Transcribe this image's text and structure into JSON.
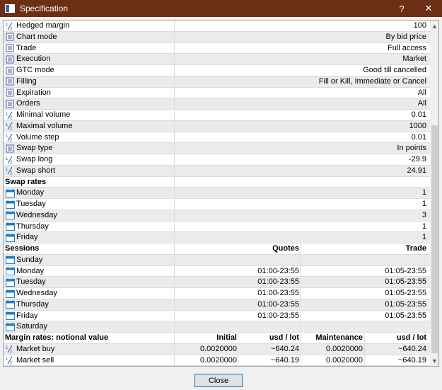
{
  "window": {
    "title": "Specification",
    "help_glyph": "?",
    "close_glyph": "✕"
  },
  "rows": [
    {
      "icon": "fraction",
      "name": "Hedged margin",
      "value": "100"
    },
    {
      "icon": "list",
      "name": "Chart mode",
      "value": "By bid price"
    },
    {
      "icon": "list",
      "name": "Trade",
      "value": "Full access"
    },
    {
      "icon": "list",
      "name": "Execution",
      "value": "Market"
    },
    {
      "icon": "list",
      "name": "GTC mode",
      "value": "Good till cancelled"
    },
    {
      "icon": "list",
      "name": "Filling",
      "value": "Fill or Kill, Immediate or Cancel"
    },
    {
      "icon": "list",
      "name": "Expiration",
      "value": "All"
    },
    {
      "icon": "list",
      "name": "Orders",
      "value": "All"
    },
    {
      "icon": "fraction",
      "name": "Minimal volume",
      "value": "0.01"
    },
    {
      "icon": "fraction",
      "name": "Maximal volume",
      "value": "1000"
    },
    {
      "icon": "fraction",
      "name": "Volume step",
      "value": "0.01"
    },
    {
      "icon": "list",
      "name": "Swap type",
      "value": "In points"
    },
    {
      "icon": "fraction",
      "name": "Swap long",
      "value": "-29.9"
    },
    {
      "icon": "fraction",
      "name": "Swap short",
      "value": "24.91"
    }
  ],
  "swap_rates": {
    "header": "Swap rates",
    "days": [
      {
        "name": "Monday",
        "value": "1"
      },
      {
        "name": "Tuesday",
        "value": "1"
      },
      {
        "name": "Wednesday",
        "value": "3"
      },
      {
        "name": "Thursday",
        "value": "1"
      },
      {
        "name": "Friday",
        "value": "1"
      }
    ]
  },
  "sessions": {
    "header": "Sessions",
    "quotes_header": "Quotes",
    "trade_header": "Trade",
    "days": [
      {
        "name": "Sunday",
        "quotes": "",
        "trade": ""
      },
      {
        "name": "Monday",
        "quotes": "01:00-23:55",
        "trade": "01:05-23:55"
      },
      {
        "name": "Tuesday",
        "quotes": "01:00-23:55",
        "trade": "01:05-23:55"
      },
      {
        "name": "Wednesday",
        "quotes": "01:00-23:55",
        "trade": "01:05-23:55"
      },
      {
        "name": "Thursday",
        "quotes": "01:00-23:55",
        "trade": "01:05-23:55"
      },
      {
        "name": "Friday",
        "quotes": "01:00-23:55",
        "trade": "01:05-23:55"
      },
      {
        "name": "Saturday",
        "quotes": "",
        "trade": ""
      }
    ]
  },
  "margin": {
    "header": "Margin rates: notional value",
    "col_initial": "Initial",
    "col_initial_unit": "usd / lot",
    "col_maintenance": "Maintenance",
    "col_maintenance_unit": "usd / lot",
    "rows": [
      {
        "name": "Market buy",
        "initial": "0.0020000",
        "initial_usd": "~640.24",
        "maintenance": "0.0020000",
        "maintenance_usd": "~640.24"
      },
      {
        "name": "Market sell",
        "initial": "0.0020000",
        "initial_usd": "~640.19",
        "maintenance": "0.0020000",
        "maintenance_usd": "~640.19"
      }
    ]
  },
  "buttons": {
    "close_label": "Close"
  },
  "colors": {
    "titlebar": "#6b2f16",
    "row_alt": "#ebebeb",
    "calendar_icon": "#1e7fc4",
    "list_icon": "#3a62b4"
  }
}
